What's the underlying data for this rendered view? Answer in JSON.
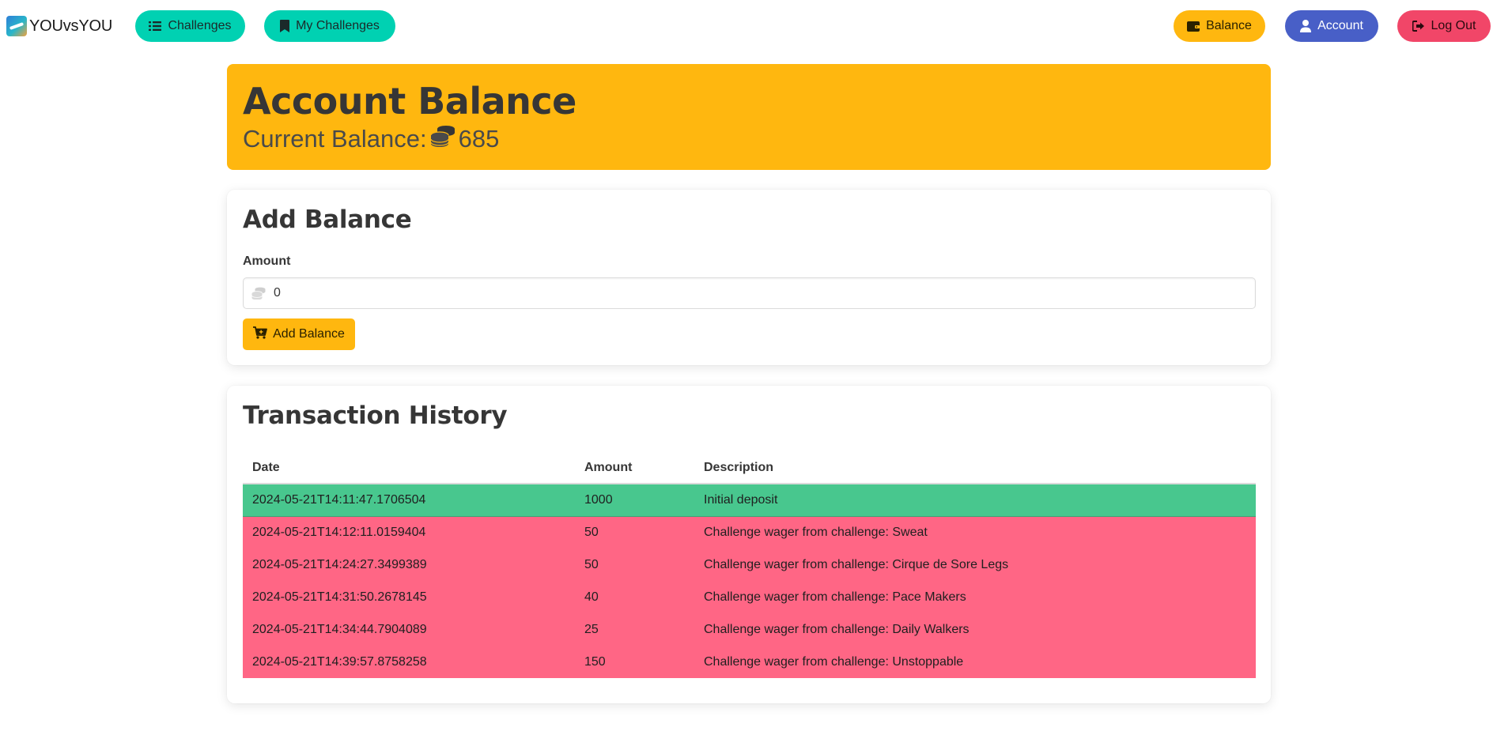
{
  "app": {
    "brand": "YOUvsYOU"
  },
  "nav": {
    "challenges": "Challenges",
    "my_challenges": "My Challenges",
    "balance": "Balance",
    "account": "Account",
    "logout": "Log Out"
  },
  "hero": {
    "title": "Account Balance",
    "balance_label": "Current Balance:",
    "balance_value": "685"
  },
  "add_balance": {
    "title": "Add Balance",
    "amount_label": "Amount",
    "amount_value": "0",
    "button_label": "Add Balance"
  },
  "history": {
    "title": "Transaction History",
    "columns": [
      "Date",
      "Amount",
      "Description"
    ],
    "rows": [
      {
        "date": "2024-05-21T14:11:47.1706504",
        "amount": "1000",
        "description": "Initial deposit",
        "type": "deposit"
      },
      {
        "date": "2024-05-21T14:12:11.0159404",
        "amount": "50",
        "description": "Challenge wager from challenge: Sweat",
        "type": "wager"
      },
      {
        "date": "2024-05-21T14:24:27.3499389",
        "amount": "50",
        "description": "Challenge wager from challenge: Cirque de Sore Legs",
        "type": "wager"
      },
      {
        "date": "2024-05-21T14:31:50.2678145",
        "amount": "40",
        "description": "Challenge wager from challenge: Pace Makers",
        "type": "wager"
      },
      {
        "date": "2024-05-21T14:34:44.7904089",
        "amount": "25",
        "description": "Challenge wager from challenge: Daily Walkers",
        "type": "wager"
      },
      {
        "date": "2024-05-21T14:39:57.8758258",
        "amount": "150",
        "description": "Challenge wager from challenge: Unstoppable",
        "type": "wager"
      }
    ]
  },
  "colors": {
    "primary": "#00d1b2",
    "warning": "#ffb70f",
    "link": "#485fc7",
    "danger": "#f14668",
    "deposit_row": "#48c78e",
    "wager_row": "#ff6685"
  },
  "icons": {
    "challenges": "list-icon",
    "my_challenges": "bookmark-icon",
    "balance": "wallet-icon",
    "account": "user-icon",
    "logout": "sign-out-icon",
    "balance_value": "coins-icon",
    "amount_input": "coins-icon",
    "add_button": "cart-plus-icon"
  }
}
